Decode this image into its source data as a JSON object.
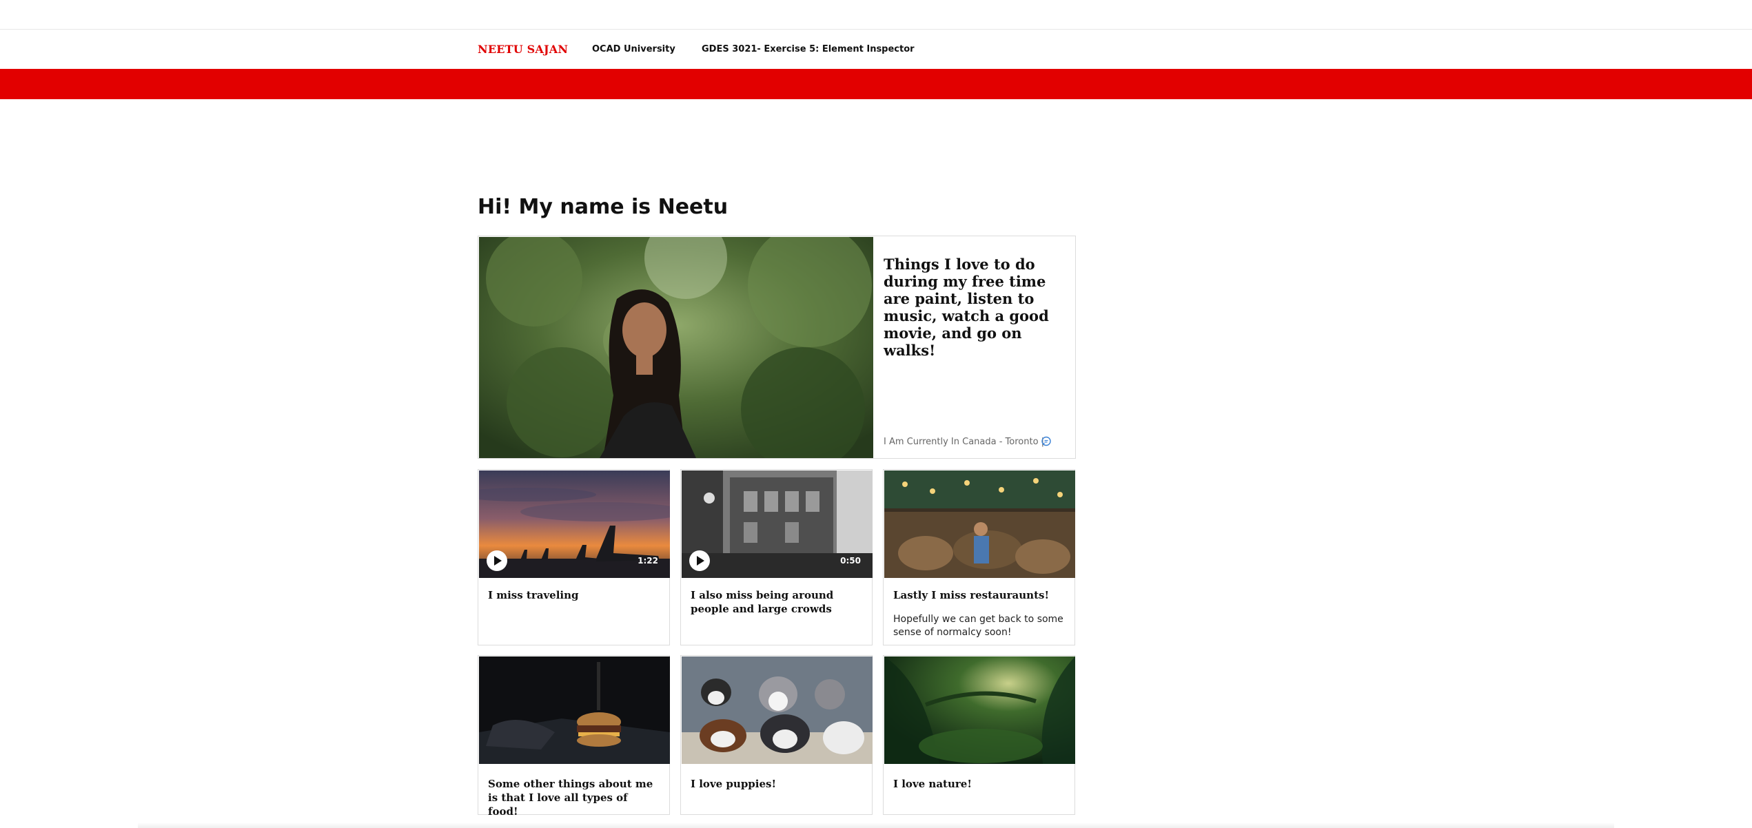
{
  "nav": {
    "brand": "NEETU SAJAN",
    "links": [
      "OCAD University",
      "GDES 3021- Exercise 5: Element Inspector"
    ]
  },
  "colors": {
    "accent": "#e20000",
    "border": "#dcdcdc"
  },
  "heading": "Hi! My name is Neetu",
  "hero": {
    "text": "Things I love to do during my free time are paint, listen to music, watch a good movie, and go on walks!",
    "location": "I Am Currently In Canada - Toronto |",
    "comment_icon": "comment-icon"
  },
  "cards": [
    {
      "title": "I miss traveling",
      "duration": "1:22",
      "video": true
    },
    {
      "title": "I also miss being around people and large crowds",
      "duration": "0:50",
      "video": true
    },
    {
      "title": "Lastly I miss restauraunts!",
      "description": "Hopefully we can get back to some sense of normalcy soon!"
    },
    {
      "title": "Some other things about me is that I love all types of food!"
    },
    {
      "title": "I love puppies!"
    },
    {
      "title": "I love nature!"
    }
  ]
}
